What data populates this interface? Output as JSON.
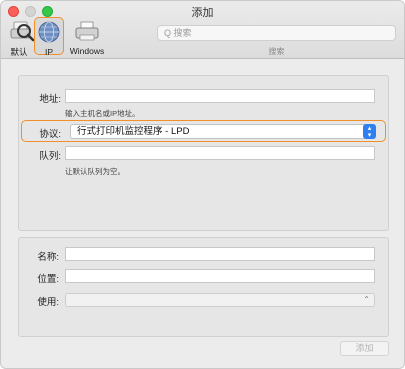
{
  "window": {
    "title": "添加"
  },
  "toolbar": {
    "default_label": "默认",
    "ip_label": "IP",
    "windows_label": "Windows",
    "search_placeholder": "Q 搜索",
    "search_caption": "搜索"
  },
  "form": {
    "address_label": "地址:",
    "address_value": "",
    "address_hint": "输入主机名或IP地址。",
    "protocol_label": "协议:",
    "protocol_value": "行式打印机监控程序 - LPD",
    "queue_label": "队列:",
    "queue_value": "",
    "queue_hint": "让默认队列为空。",
    "name_label": "名称:",
    "name_value": "",
    "location_label": "位置:",
    "location_value": "",
    "use_label": "使用:",
    "use_value": ""
  },
  "actions": {
    "add_label": "添加"
  },
  "colors": {
    "highlight": "#f0902a",
    "accent": "#2f7ff0"
  },
  "icons": [
    "default-printer-icon",
    "ip-globe-icon",
    "windows-printer-icon",
    "stepper-icon",
    "chevron-updown-icon"
  ]
}
